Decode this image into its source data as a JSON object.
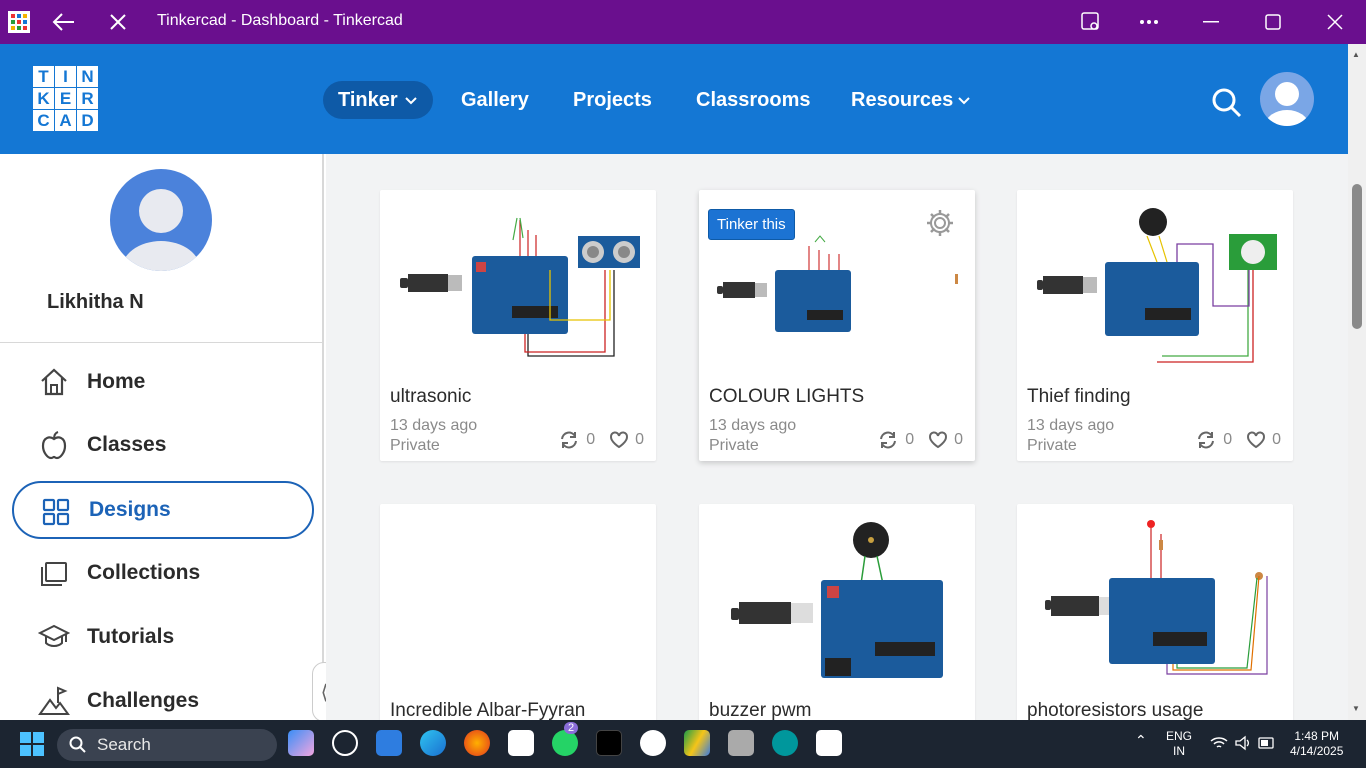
{
  "window": {
    "title": "Tinkercad - Dashboard - Tinkercad"
  },
  "logo": {
    "letters": [
      "T",
      "I",
      "N",
      "K",
      "E",
      "R",
      "C",
      "A",
      "D"
    ]
  },
  "nav": {
    "tinker": "Tinker",
    "gallery": "Gallery",
    "projects": "Projects",
    "classrooms": "Classrooms",
    "resources": "Resources"
  },
  "profile": {
    "name": "Likhitha N"
  },
  "sidebar": {
    "items": [
      {
        "label": "Home",
        "icon": "home-icon"
      },
      {
        "label": "Classes",
        "icon": "apple-icon"
      },
      {
        "label": "Designs",
        "icon": "grid-icon",
        "active": true
      },
      {
        "label": "Collections",
        "icon": "folder-icon"
      },
      {
        "label": "Tutorials",
        "icon": "graduation-cap-icon"
      },
      {
        "label": "Challenges",
        "icon": "mountain-flag-icon"
      }
    ]
  },
  "designs": [
    {
      "title": "ultrasonic",
      "date": "13 days ago",
      "privacy": "Private",
      "remixes": "0",
      "likes": "0"
    },
    {
      "title": "COLOUR LIGHTS",
      "date": "13 days ago",
      "privacy": "Private",
      "remixes": "0",
      "likes": "0",
      "hover_label": "Tinker this"
    },
    {
      "title": "Thief finding",
      "date": "13 days ago",
      "privacy": "Private",
      "remixes": "0",
      "likes": "0"
    },
    {
      "title": "Incredible Albar-Fyyran"
    },
    {
      "title": "buzzer pwm"
    },
    {
      "title": "photoresistors usage"
    }
  ],
  "taskbar": {
    "search_placeholder": "Search",
    "whatsapp_badge": "2",
    "lang_line1": "ENG",
    "lang_line2": "IN",
    "time": "1:48 PM",
    "date": "4/14/2025"
  },
  "colors": {
    "titlebar": "#6a0f8e",
    "header": "#1477d4",
    "accent": "#1c63b7"
  }
}
